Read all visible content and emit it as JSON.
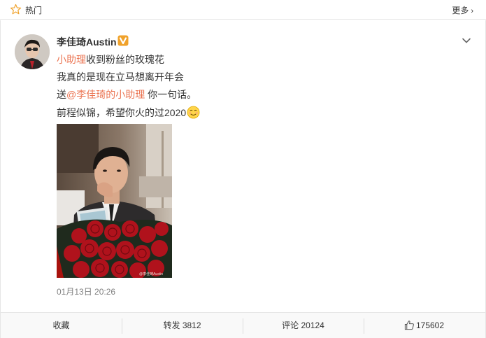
{
  "section": {
    "title": "热门",
    "more_label": "更多",
    "more_chevron": "›"
  },
  "post": {
    "author": "李佳琦Austin",
    "verified_badge_color": "#f0a22b",
    "line1": {
      "link": "小助理",
      "text": "收到粉丝的玫瑰花"
    },
    "line2": "我真的是现在立马想离开年会",
    "line3": {
      "prefix": "送",
      "mention": "@李佳琦的小助理",
      "suffix": " 你一句话。"
    },
    "line4": "前程似锦，希望你火的过2020",
    "emoji_name": "awkward-smile-emoji",
    "photo_watermark": "@李佳琦Austin",
    "timestamp": "01月13日 20:26"
  },
  "actions": {
    "favorite": "收藏",
    "repost": "转发 3812",
    "comment": "评论 20124",
    "like": "175602"
  },
  "colors": {
    "link": "#eb7350",
    "text": "#333333",
    "muted": "#808080",
    "border": "#e6e6e6"
  }
}
